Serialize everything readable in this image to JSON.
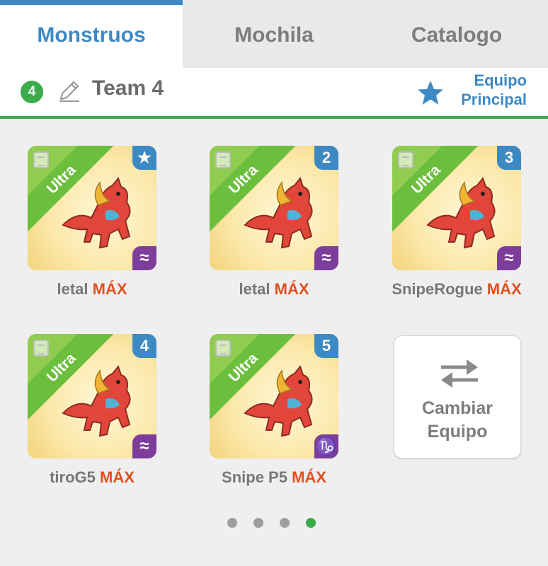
{
  "tabs": [
    {
      "label": "Monstruos",
      "active": true
    },
    {
      "label": "Mochila",
      "active": false
    },
    {
      "label": "Catalogo",
      "active": false
    }
  ],
  "team": {
    "badge": "4",
    "name": "Team 4",
    "main_label_line1": "Equipo",
    "main_label_line2": "Principal"
  },
  "monsters": [
    {
      "rarity": "Ultra",
      "badge": "★",
      "element": "≈",
      "name": "letal",
      "level": "MÁX"
    },
    {
      "rarity": "Ultra",
      "badge": "2",
      "element": "≈",
      "name": "letal",
      "level": "MÁX"
    },
    {
      "rarity": "Ultra",
      "badge": "3",
      "element": "≈",
      "name": "SnipeRogue",
      "level": "MÁX"
    },
    {
      "rarity": "Ultra",
      "badge": "4",
      "element": "≈",
      "name": "tiroG5",
      "level": "MÁX"
    },
    {
      "rarity": "Ultra",
      "badge": "5",
      "element": "♑",
      "name": "Snipe P5",
      "level": "MÁX"
    }
  ],
  "change_team": {
    "line1": "Cambiar",
    "line2": "Equipo"
  },
  "pagination": {
    "pages": 4,
    "current": 4
  },
  "colors": {
    "accent": "#3d89c4",
    "green": "#3daa4b",
    "max": "#e0501f",
    "element_purple": "#7d3d9a"
  }
}
